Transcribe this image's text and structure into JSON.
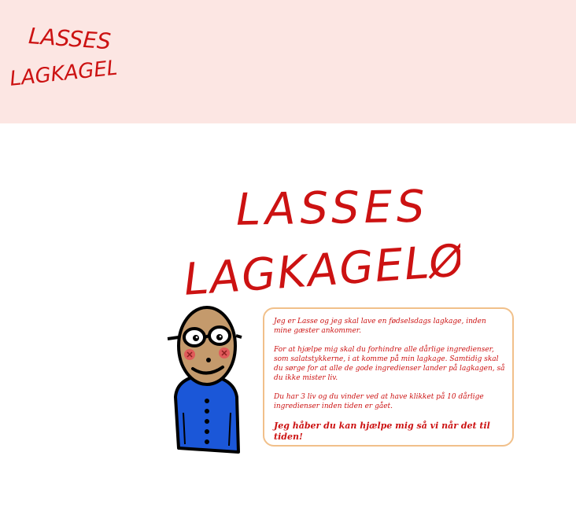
{
  "brand": {
    "line1": "LASSES",
    "line2": "LAGKAGELØB",
    "color": "#cc1212"
  },
  "header": {
    "background": "#fce6e3"
  },
  "intro": {
    "paragraph1": "Jeg er Lasse og jeg skal lave en fødselsdags lagkage, inden mine gæster ankommer.",
    "paragraph2": "For at hjælpe mig skal du forhindre alle dårlige ingredienser, som salatstykkerne, i at komme på min lagkage. Samtidig skal du sørge for at alle de gode ingredienser lander på lagkagen, så du ikke mister liv.",
    "paragraph3": "Du har 3 liv og du vinder ved at have klikket på 10 dårlige ingredienser inden tiden er gået.",
    "closing": "Jeg håber du kan hjælpe mig så vi når det til tiden!"
  },
  "character": {
    "icon": "lasse-character-icon"
  }
}
